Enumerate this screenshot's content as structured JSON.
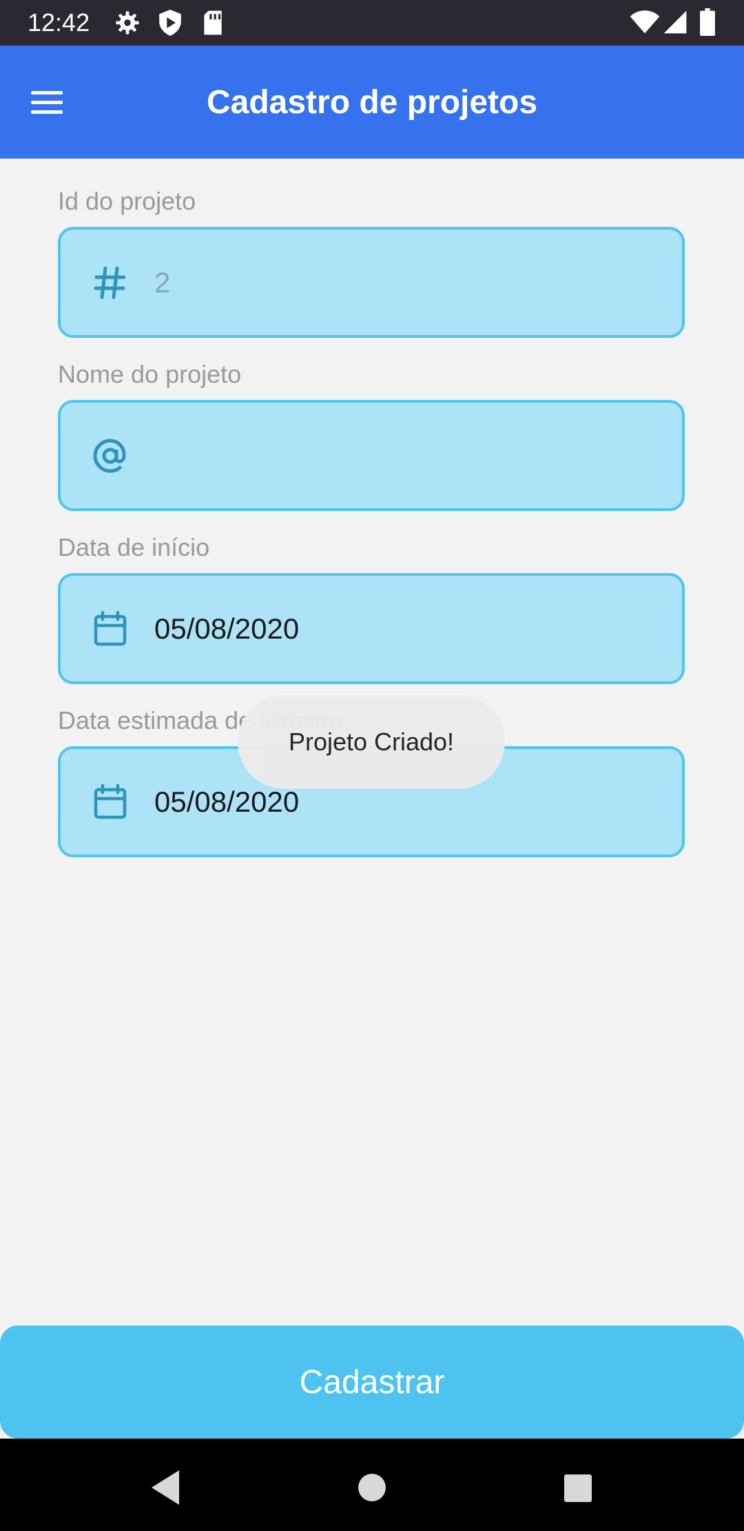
{
  "status_bar": {
    "time": "12:42",
    "left_icons": [
      "gear-icon",
      "shield-icon",
      "sd-card-icon"
    ],
    "right_icons": [
      "wifi-icon",
      "signal-icon",
      "battery-icon"
    ]
  },
  "app_bar": {
    "title": "Cadastro de projetos",
    "menu_icon": "hamburger-menu-icon",
    "color": "#3672ed"
  },
  "form": {
    "fields": [
      {
        "label": "Id do projeto",
        "icon": "hash-icon",
        "value": "2",
        "value_is_placeholder": true
      },
      {
        "label": "Nome do projeto",
        "icon": "at-sign-icon",
        "value": ""
      },
      {
        "label": "Data de início",
        "icon": "calendar-icon",
        "value": "05/08/2020"
      },
      {
        "label": "Data estimada de término",
        "icon": "calendar-icon",
        "value": "05/08/2020"
      }
    ],
    "field_color": "#ade3f6",
    "field_border_color": "#4fc5ef"
  },
  "toast": {
    "message": "Projeto Criado!"
  },
  "submit_button": {
    "label": "Cadastrar",
    "color": "#4ec3ef"
  },
  "nav_bar": {
    "buttons": [
      "back-icon",
      "home-icon",
      "recents-icon"
    ]
  }
}
